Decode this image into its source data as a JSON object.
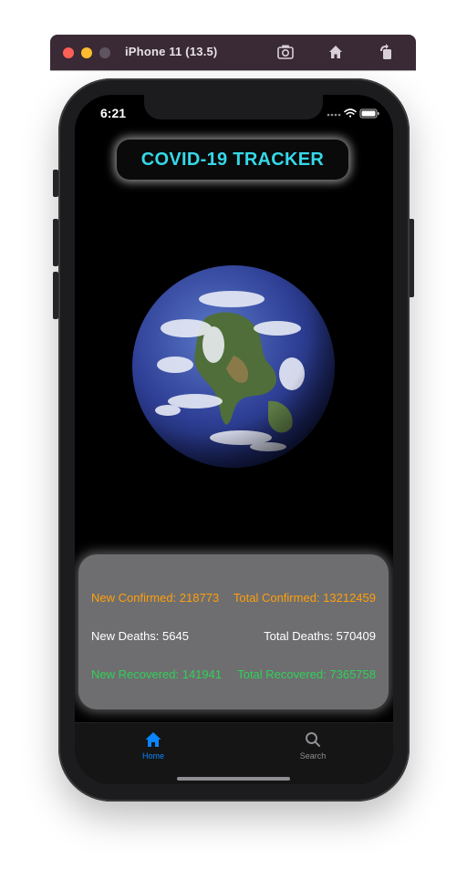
{
  "simulator": {
    "device_title": "iPhone 11 (13.5)",
    "icons": [
      "screenshot-icon",
      "home-icon",
      "rotate-icon"
    ]
  },
  "status_bar": {
    "time": "6:21"
  },
  "app": {
    "title": "COVID-19 TRACKER",
    "accent_color": "#35d8e8"
  },
  "stats": {
    "new_confirmed": "New Confirmed: 218773",
    "total_confirmed": "Total Confirmed: 13212459",
    "new_deaths": "New Deaths: 5645",
    "total_deaths": "Total Deaths: 570409",
    "new_recovered": "New Recovered: 141941",
    "total_recovered": "Total Recovered: 7365758",
    "colors": {
      "confirmed": "#ff9f0a",
      "deaths": "#ffffff",
      "recovered": "#30d158"
    }
  },
  "tabs": [
    {
      "label": "Home",
      "icon": "house-icon",
      "active": true
    },
    {
      "label": "Search",
      "icon": "magnifier-icon",
      "active": false
    }
  ]
}
